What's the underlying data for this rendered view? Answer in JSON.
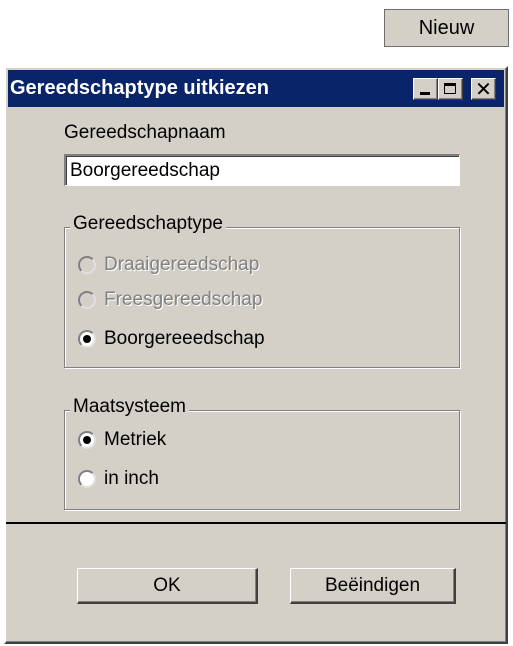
{
  "toolbar": {
    "new_label": "Nieuw"
  },
  "dialog": {
    "title": "Gereedschaptype uitkiezen",
    "title_buttons": [
      "minimize-icon",
      "maximize-icon",
      "close-icon"
    ],
    "name_label": "Gereedschapnaam",
    "name_value": "Boorgereedschap",
    "tooltype_group": {
      "legend": "Gereedschaptype",
      "options": [
        {
          "label": "Draaigereedschap",
          "selected": false,
          "enabled": false
        },
        {
          "label": "Freesgereedschap",
          "selected": false,
          "enabled": false
        },
        {
          "label": "Boorgereeedschap",
          "selected": true,
          "enabled": true
        }
      ]
    },
    "units_group": {
      "legend": "Maatsysteem",
      "options": [
        {
          "label": "Metriek",
          "selected": true,
          "enabled": true
        },
        {
          "label": "in inch",
          "selected": false,
          "enabled": true
        }
      ]
    },
    "ok_label": "OK",
    "cancel_label": "Beëindigen"
  },
  "colors": {
    "titlebar": "#0a246a",
    "face": "#d4d0c8",
    "disabled_text": "#808080"
  }
}
